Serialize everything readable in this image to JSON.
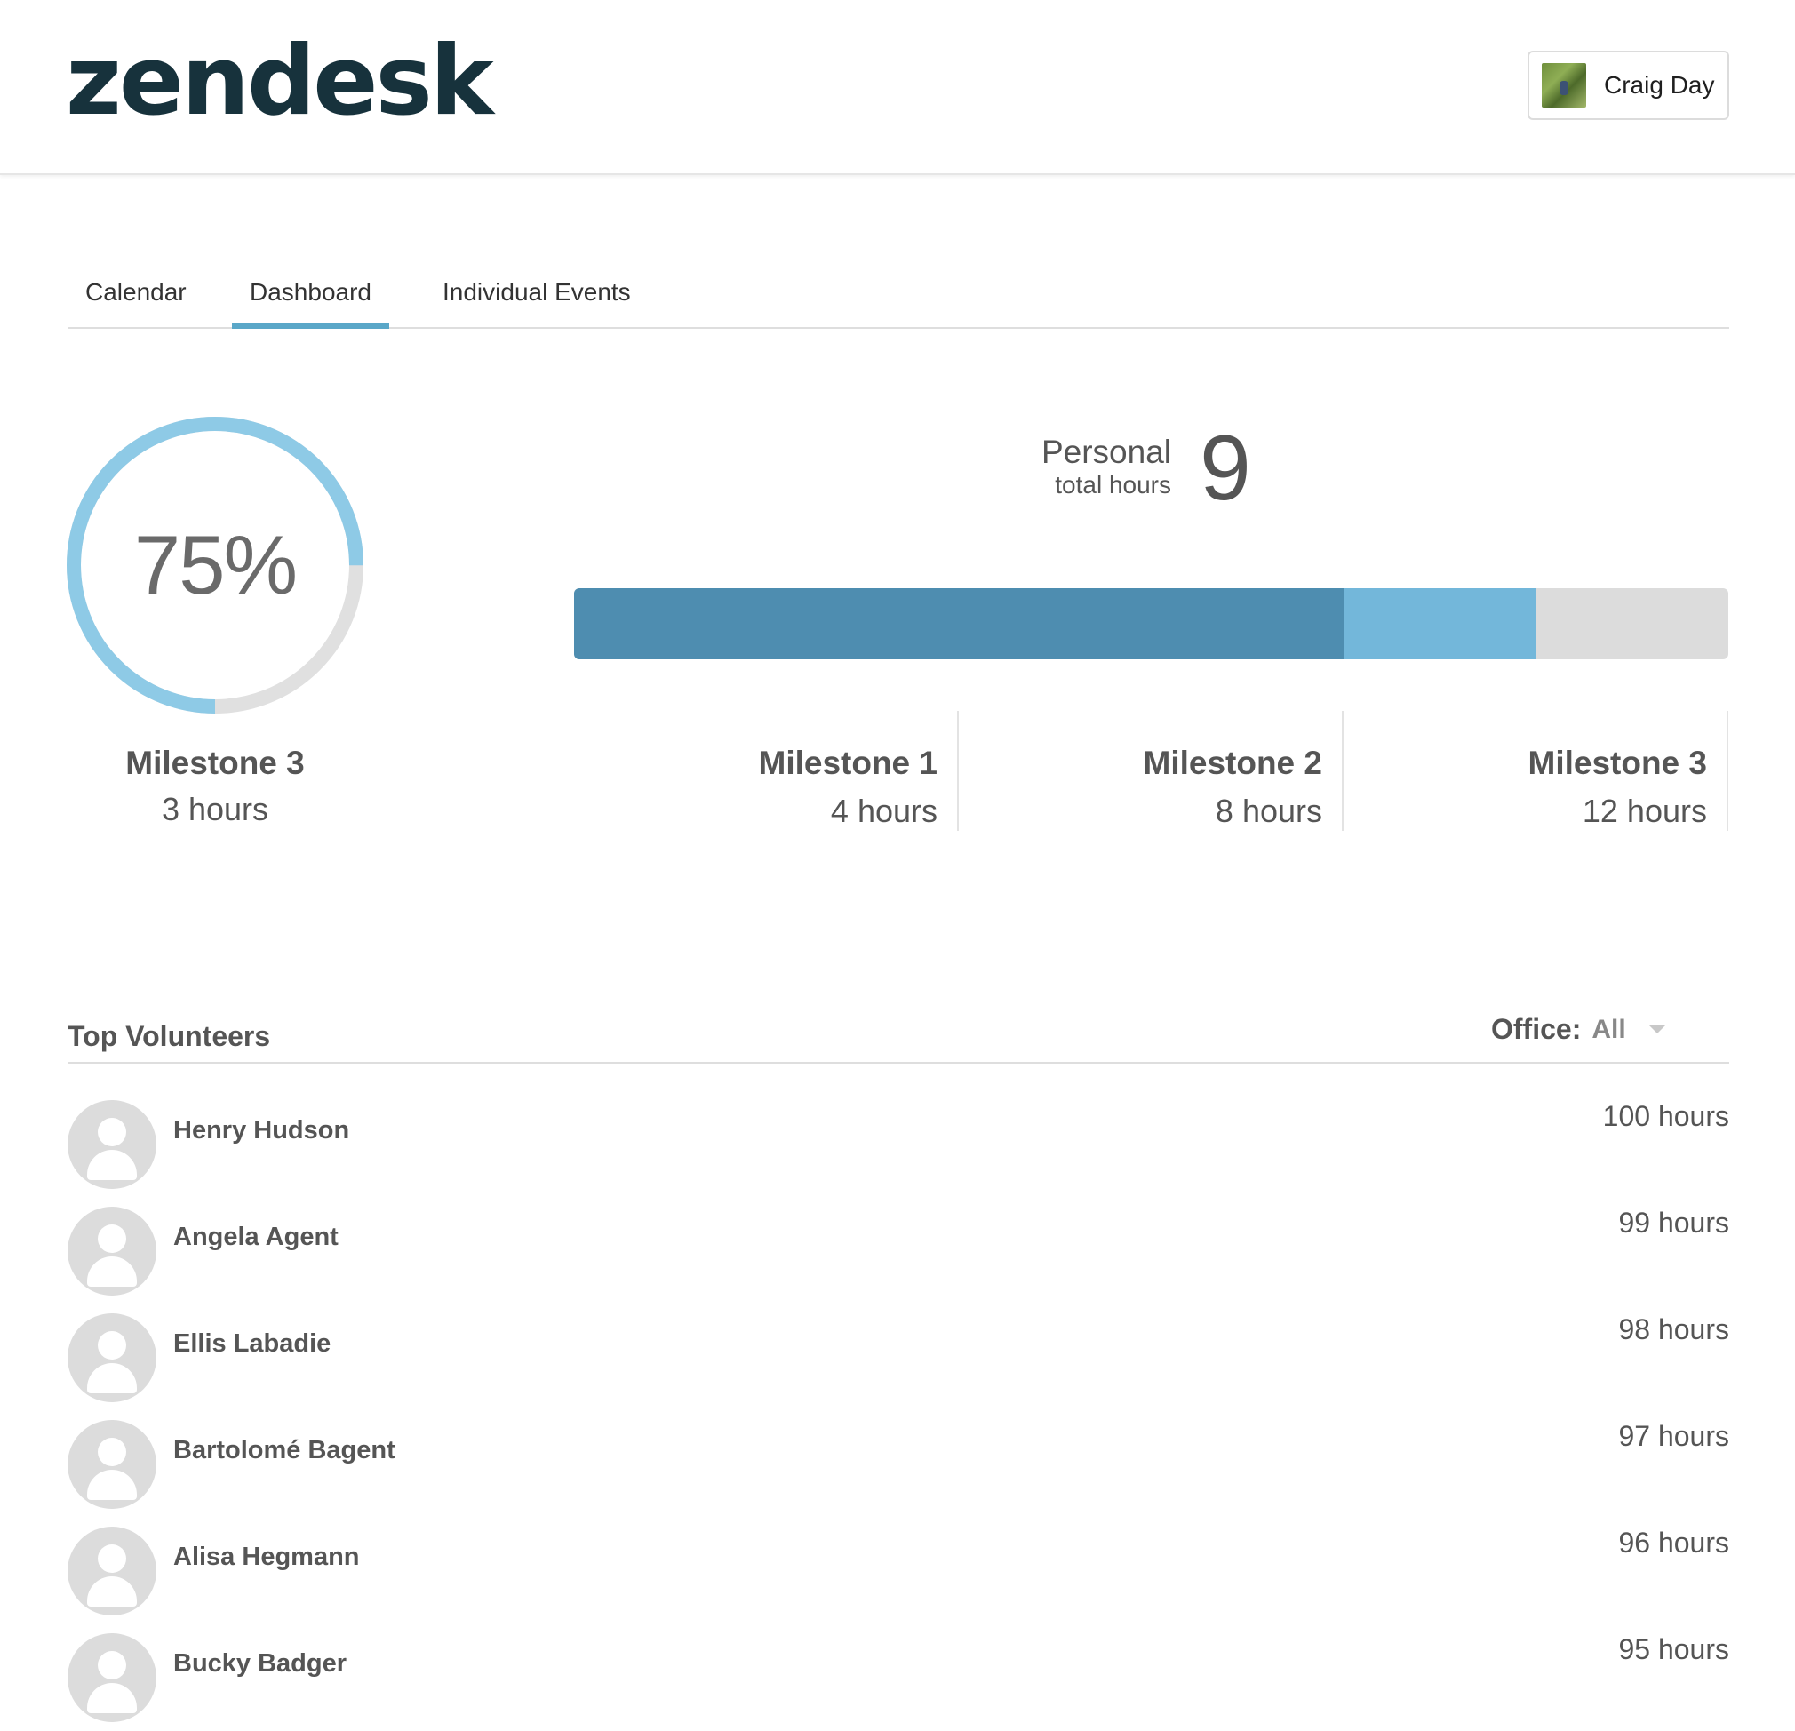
{
  "header": {
    "logo_text": "zendesk",
    "user_name": "Craig Day"
  },
  "tabs": [
    {
      "label": "Calendar",
      "active": false
    },
    {
      "label": "Dashboard",
      "active": true
    },
    {
      "label": "Individual Events",
      "active": false
    }
  ],
  "current_milestone": {
    "percent_text": "75%",
    "percent_value": 0.75,
    "title": "Milestone 3",
    "hours_text": "3 hours",
    "ring_color": "#8ecae6",
    "track_color": "#e0e0e0"
  },
  "personal": {
    "label": "Personal",
    "sublabel": "total hours",
    "total": "9"
  },
  "progress": {
    "total_hours": 9,
    "max_hours": 12,
    "completed_milestone_hours": 8,
    "colors": {
      "completed": "#4e8db0",
      "current": "#73b7da",
      "remaining": "#dcdcdc"
    }
  },
  "milestones": [
    {
      "title": "Milestone 1",
      "hours_text": "4 hours"
    },
    {
      "title": "Milestone 2",
      "hours_text": "8 hours"
    },
    {
      "title": "Milestone 3",
      "hours_text": "12 hours"
    }
  ],
  "top_volunteers": {
    "title": "Top Volunteers",
    "office_label": "Office:",
    "office_value": "All",
    "rows": [
      {
        "name": "Henry Hudson",
        "hours": "100 hours"
      },
      {
        "name": "Angela Agent",
        "hours": "99 hours"
      },
      {
        "name": "Ellis Labadie",
        "hours": "98 hours"
      },
      {
        "name": "Bartolomé Bagent",
        "hours": "97 hours"
      },
      {
        "name": "Alisa Hegmann",
        "hours": "96 hours"
      },
      {
        "name": "Bucky Badger",
        "hours": "95 hours"
      }
    ]
  }
}
